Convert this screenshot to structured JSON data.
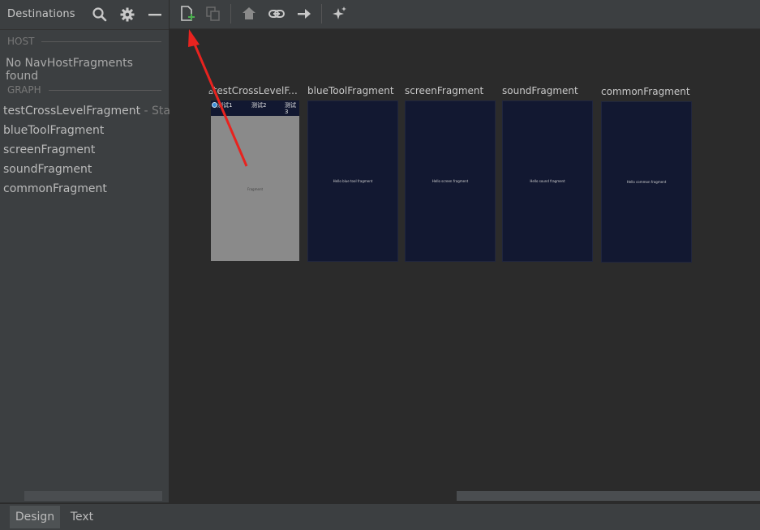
{
  "left_panel": {
    "title": "Destinations",
    "host_section": "HOST",
    "host_empty": "No NavHostFragments found",
    "graph_section": "GRAPH",
    "graph_items": [
      {
        "name": "testCrossLevelFragment",
        "suffix": " - Start"
      },
      {
        "name": "blueToolFragment"
      },
      {
        "name": "screenFragment"
      },
      {
        "name": "soundFragment"
      },
      {
        "name": "commonFragment"
      }
    ]
  },
  "toolbar": {
    "icons": [
      "new-destination-icon",
      "nested-graph-icon",
      "home-icon",
      "link-icon",
      "arrow-right-icon",
      "sparkle-icon"
    ]
  },
  "canvas": {
    "destinations": [
      {
        "label": "testCrossLevelF...",
        "tabs": [
          "测试1",
          "测试2",
          "测试\n3"
        ],
        "text": "Fragment"
      },
      {
        "label": "blueToolFragment",
        "text": "Hello blue tool fragment"
      },
      {
        "label": "screenFragment",
        "text": "Hello screen fragment"
      },
      {
        "label": "soundFragment",
        "text": "Hello sound fragment"
      },
      {
        "label": "commonFragment",
        "text": "Hello common fragment"
      }
    ]
  },
  "bottom_tabs": [
    {
      "label": "Design",
      "active": true
    },
    {
      "label": "Text",
      "active": false
    }
  ],
  "colors": {
    "panel_bg": "#3c3f41",
    "canvas_bg": "#2b2b2b",
    "fragment_bg": "#121831",
    "annotation_arrow": "#e8231f",
    "add_accent": "#4caf50"
  }
}
